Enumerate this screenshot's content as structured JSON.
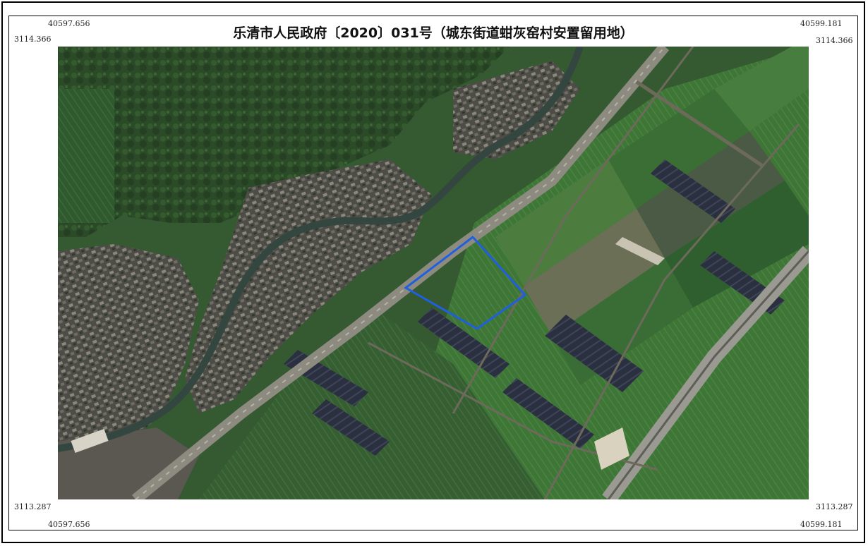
{
  "title": "乐清市人民政府〔2020〕031号（城东街道蚶灰窑村安置留用地）",
  "coords": {
    "top_left_x": "40597.656",
    "top_right_x": "40599.181",
    "top_y": "3114.366",
    "bottom_y": "3113.287",
    "bottom_left_x": "40597.656",
    "bottom_right_x": "40599.181"
  },
  "boundary": {
    "color": "#1f5fe0",
    "label": ""
  },
  "colors": {
    "forest": "#2e4d2a",
    "paddy": "#3f7a3a",
    "village": "#55524b",
    "road": "#8d8a80",
    "river": "#3a4a44",
    "dark_greenhouse": "#2a2f3d"
  }
}
